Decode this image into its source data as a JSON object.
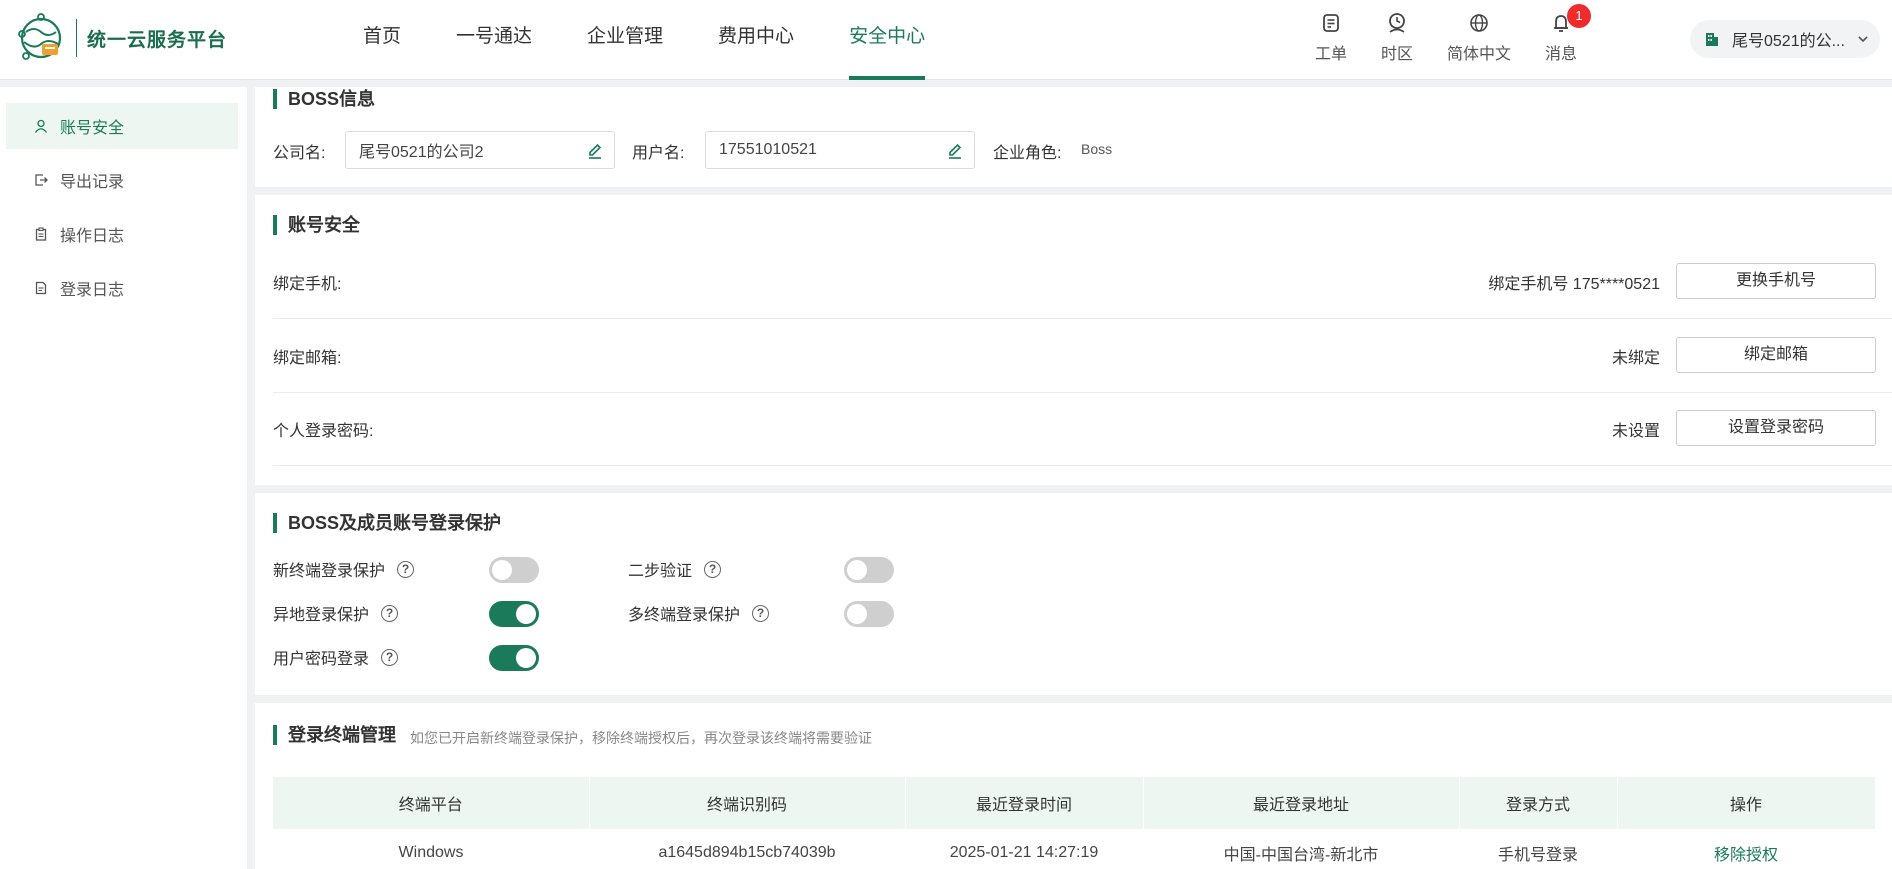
{
  "header": {
    "logo_text": "统一云服务平台",
    "nav": [
      "首页",
      "一号通达",
      "企业管理",
      "费用中心",
      "安全中心"
    ],
    "active_nav": "安全中心",
    "tools": [
      {
        "label": "工单",
        "icon": "ticket-icon"
      },
      {
        "label": "时区",
        "icon": "clock-icon"
      },
      {
        "label": "简体中文",
        "icon": "globe-icon"
      },
      {
        "label": "消息",
        "icon": "bell-icon",
        "badge": "1"
      }
    ],
    "company": "尾号0521的公..."
  },
  "sidebar": {
    "items": [
      {
        "label": "账号安全",
        "icon": "user-icon"
      },
      {
        "label": "导出记录",
        "icon": "export-icon"
      },
      {
        "label": "操作日志",
        "icon": "clipboard-icon"
      },
      {
        "label": "登录日志",
        "icon": "document-icon"
      }
    ]
  },
  "boss": {
    "title": "BOSS信息",
    "company_label": "公司名:",
    "company_value": "尾号0521的公司2",
    "username_label": "用户名:",
    "username_value": "17551010521",
    "role_label": "企业角色:",
    "role_value": "Boss"
  },
  "account": {
    "title": "账号安全",
    "rows": [
      {
        "label": "绑定手机:",
        "status": "绑定手机号 175****0521",
        "button": "更换手机号"
      },
      {
        "label": "绑定邮箱:",
        "status": "未绑定",
        "button": "绑定邮箱"
      },
      {
        "label": "个人登录密码:",
        "status": "未设置",
        "button": "设置登录密码"
      }
    ]
  },
  "protection": {
    "title": "BOSS及成员账号登录保护",
    "toggles": [
      {
        "label": "新终端登录保护",
        "on": false
      },
      {
        "label": "二步验证",
        "on": false
      },
      {
        "label": "异地登录保护",
        "on": true
      },
      {
        "label": "多终端登录保护",
        "on": false
      },
      {
        "label": "用户密码登录",
        "on": true
      }
    ]
  },
  "terminals": {
    "title": "登录终端管理",
    "hint": "如您已开启新终端登录保护，移除终端授权后，再次登录该终端将需要验证",
    "columns": [
      "终端平台",
      "终端识别码",
      "最近登录时间",
      "最近登录地址",
      "登录方式",
      "操作"
    ],
    "rows": [
      [
        "Windows",
        "a1645d894b15cb74039b",
        "2025-01-21 14:27:19",
        "中国-中国台湾-新北市",
        "手机号登录",
        "移除授权"
      ]
    ]
  },
  "colors": {
    "accent": "#1a7a5a",
    "badge": "#ef2b2b"
  }
}
